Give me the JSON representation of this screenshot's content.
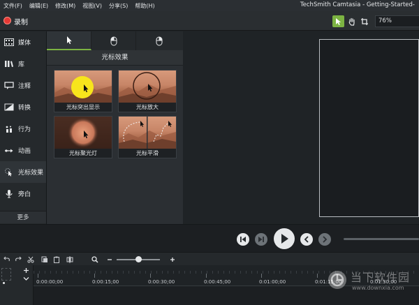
{
  "menubar": {
    "items": [
      "文件(F)",
      "编辑(E)",
      "修改(M)",
      "视图(V)",
      "分享(S)",
      "帮助(H)"
    ],
    "app_title": "TechSmith Camtasia - Getting-Started-"
  },
  "toolbar": {
    "record_label": "录制",
    "zoom_value": "76%",
    "accent_color": "#7cb342",
    "record_color": "#e53935"
  },
  "sidebar": {
    "items": [
      {
        "label": "媒体",
        "icon": "film-icon"
      },
      {
        "label": "库",
        "icon": "library-icon"
      },
      {
        "label": "注释",
        "icon": "annotation-icon"
      },
      {
        "label": "转换",
        "icon": "transition-icon"
      },
      {
        "label": "行为",
        "icon": "behavior-icon"
      },
      {
        "label": "动画",
        "icon": "animation-icon"
      },
      {
        "label": "光标效果",
        "icon": "cursor-effects-icon"
      },
      {
        "label": "旁白",
        "icon": "microphone-icon"
      }
    ],
    "more_label": "更多"
  },
  "panel": {
    "tabs": [
      {
        "icon": "cursor-arrow-icon"
      },
      {
        "icon": "mouse-left-click-icon"
      },
      {
        "icon": "mouse-right-click-icon"
      }
    ],
    "title": "光标效果",
    "effects": [
      {
        "label": "光标突出显示"
      },
      {
        "label": "光标放大"
      },
      {
        "label": "光标聚光灯"
      },
      {
        "label": "光标平滑"
      }
    ]
  },
  "timeline": {
    "ticks": [
      "0:00:00;00",
      "0:00:15;00",
      "0:00:30;00",
      "0:00:45;00",
      "0:01:00;00",
      "0:01:15;00",
      "0:01:30;00"
    ]
  },
  "watermark": {
    "brand": "当下软件园",
    "url": "www.downxia.com"
  }
}
